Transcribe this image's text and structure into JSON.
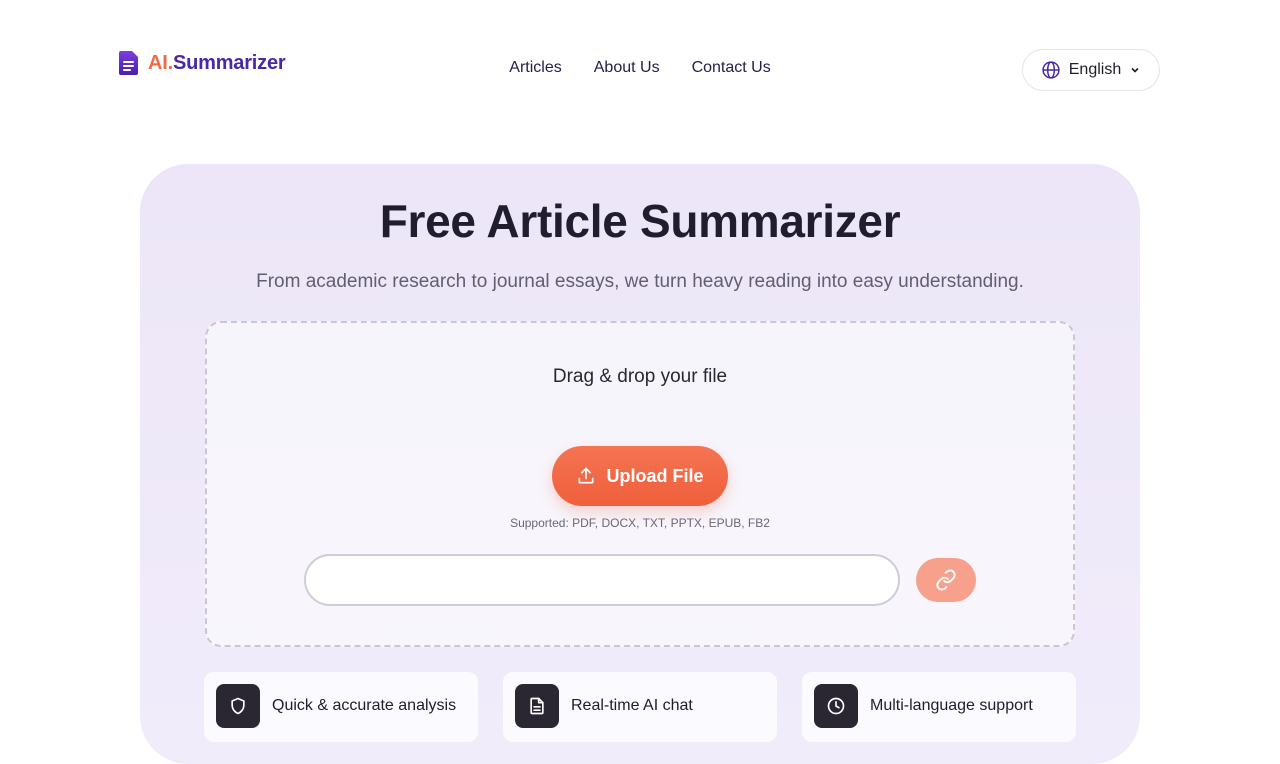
{
  "brand": {
    "ai": "AI.",
    "rest": "Summarizer",
    "icon": "document-icon",
    "colors": {
      "ai": "#f26b43",
      "rest": "#4a27a8"
    }
  },
  "nav": {
    "items": [
      {
        "label": "Articles"
      },
      {
        "label": "About Us"
      },
      {
        "label": "Contact Us"
      }
    ]
  },
  "language": {
    "selected": "English",
    "icon": "globe-icon"
  },
  "hero": {
    "title": "Free Article Summarizer",
    "subtitle": "From academic research to journal essays, we turn heavy reading into easy understanding."
  },
  "upload": {
    "drop_title": "Drag & drop your file",
    "button_label": "Upload File",
    "supported": "Supported: PDF, DOCX, TXT, PPTX, EPUB, FB2",
    "url_value": "",
    "url_placeholder": "",
    "accent": "#ef5f3c"
  },
  "features": [
    {
      "label": "Quick & accurate analysis",
      "icon": "shield-icon"
    },
    {
      "label": "Real-time AI chat",
      "icon": "file-text-icon"
    },
    {
      "label": "Multi-language support",
      "icon": "clock-icon"
    }
  ]
}
